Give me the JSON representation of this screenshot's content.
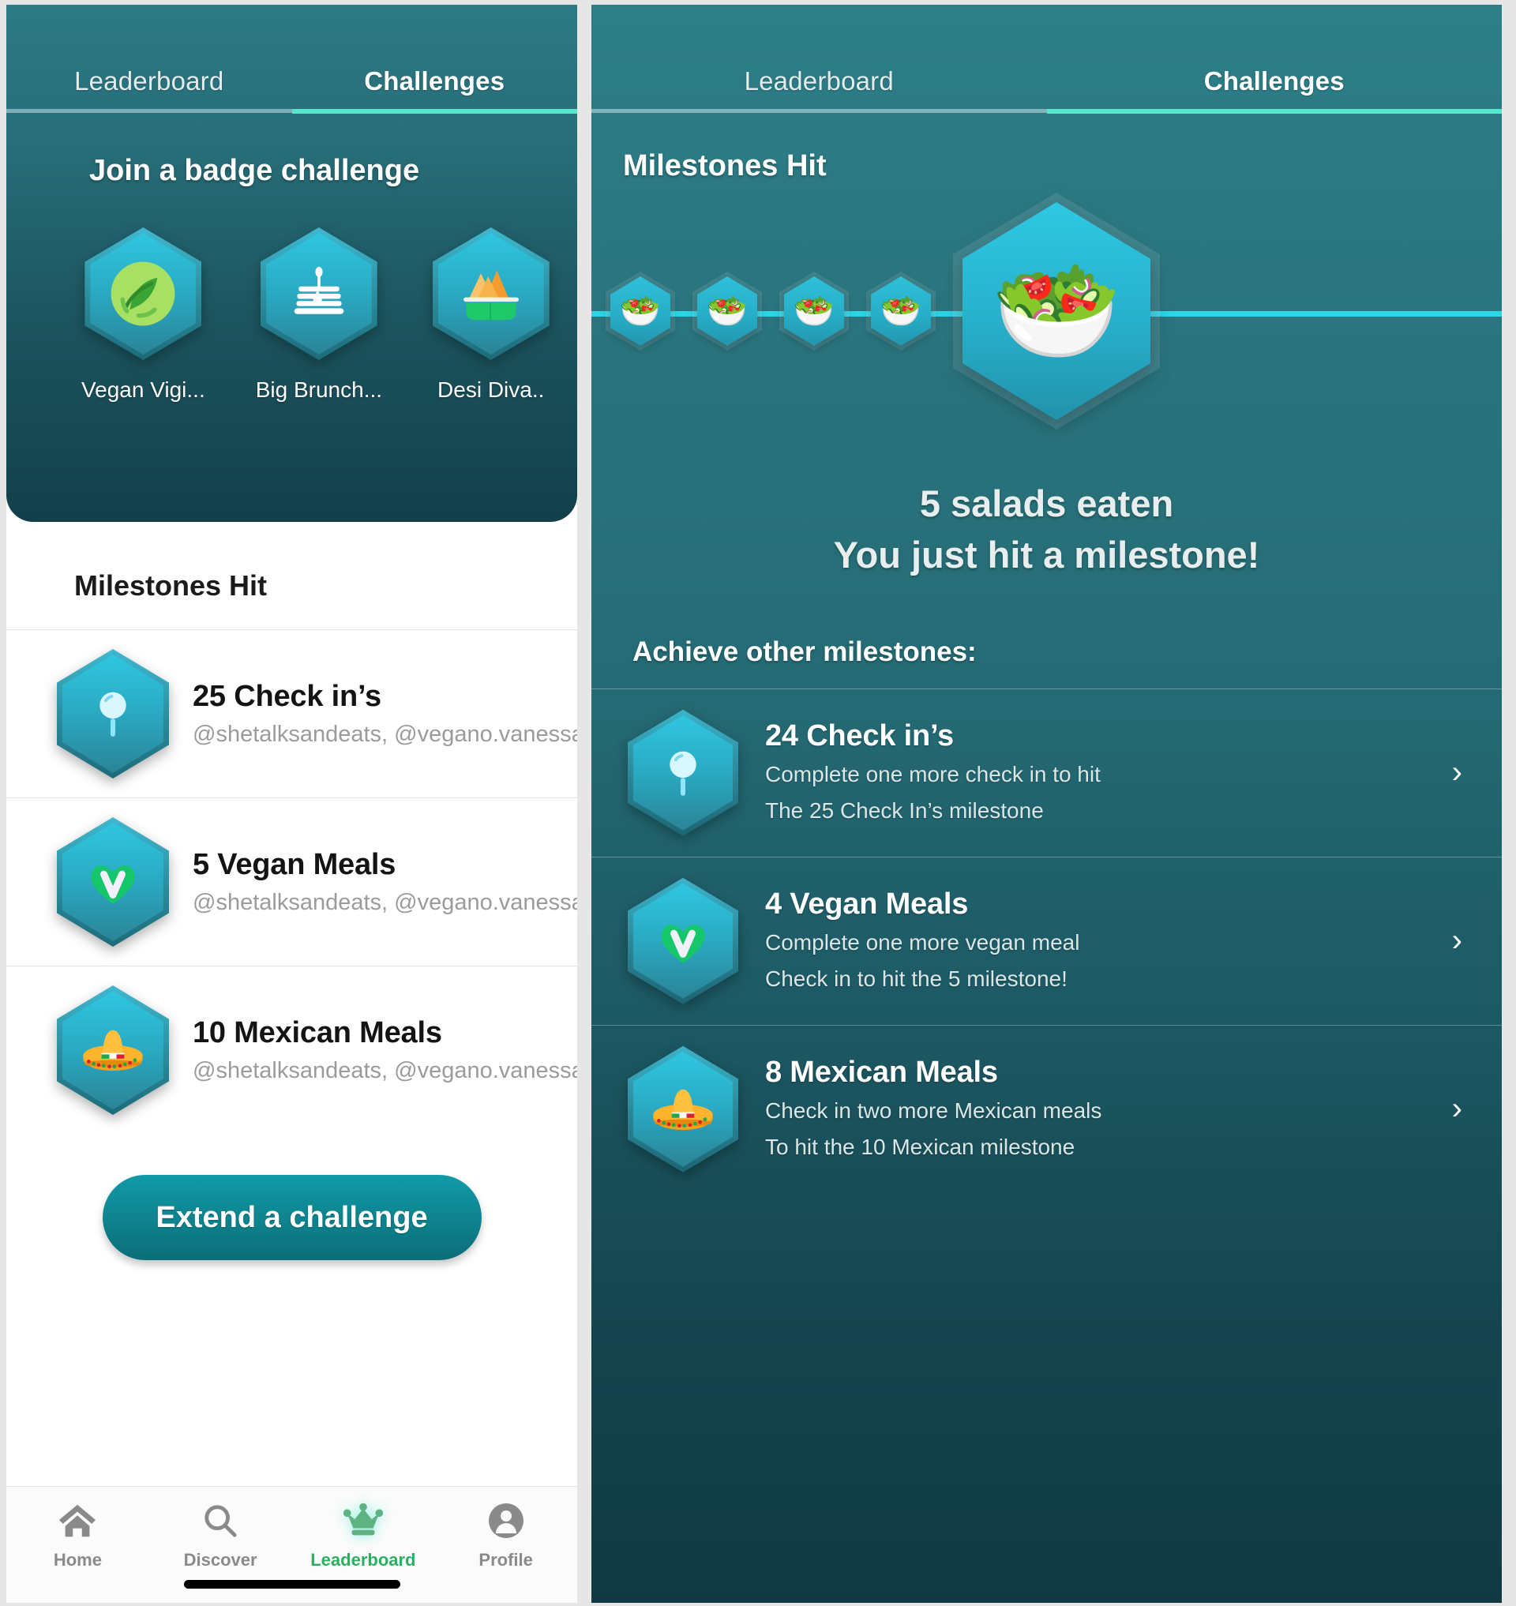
{
  "tabs": {
    "leaderboard": "Leaderboard",
    "challenges": "Challenges",
    "active": "Challenges"
  },
  "colors": {
    "accent_teal": "#2bd6e8",
    "tab_active_underline": "#55e8c8",
    "header_gradient_top": "#2d7a84",
    "header_gradient_bottom": "#123f4a",
    "nav_active_green": "#2fae63",
    "button_teal": "#0e8792",
    "sub_text_gray": "#9b9b9b"
  },
  "left_screen": {
    "hero_title": "Join a badge challenge",
    "badge_challenges": [
      {
        "label": "Vegan Vigi...",
        "icon": "leaf-badge-icon"
      },
      {
        "label": "Big Brunch...",
        "icon": "pancake-badge-icon"
      },
      {
        "label": "Desi Diva..",
        "icon": "samosa-badge-icon"
      },
      {
        "label": "",
        "icon": "partial-badge-icon"
      }
    ],
    "section_title": "Milestones Hit",
    "milestones": [
      {
        "title": "25 Check in’s",
        "subtitle": "@shetalksandeats, @vegano.vanessa",
        "icon": "magnifier-badge-icon",
        "chevron": "›"
      },
      {
        "title": "5 Vegan Meals",
        "subtitle": "@shetalksandeats, @vegano.vanessa",
        "icon": "vegan-heart-badge-icon",
        "chevron": "›"
      },
      {
        "title": "10 Mexican Meals",
        "subtitle": "@shetalksandeats, @vegano.vanessa",
        "icon": "sombrero-badge-icon",
        "chevron": "›"
      }
    ],
    "extend_button": "Extend a challenge",
    "bottom_nav": [
      {
        "label": "Home",
        "icon": "home-icon",
        "active": false
      },
      {
        "label": "Discover",
        "icon": "search-icon",
        "active": false
      },
      {
        "label": "Leaderboard",
        "icon": "crown-icon",
        "active": true
      },
      {
        "label": "Profile",
        "icon": "person-icon",
        "active": false
      }
    ]
  },
  "right_screen": {
    "title": "Milestones Hit",
    "progress_steps": [
      {
        "icon": "salad-icon",
        "size": "small"
      },
      {
        "icon": "salad-icon",
        "size": "small"
      },
      {
        "icon": "salad-icon",
        "size": "small"
      },
      {
        "icon": "salad-icon",
        "size": "small"
      },
      {
        "icon": "salad-icon",
        "size": "large"
      }
    ],
    "headline_line1": "5 salads eaten",
    "headline_line2": "You just hit a milestone!",
    "subheading": "Achieve other milestones:",
    "milestones": [
      {
        "title": "24 Check in’s",
        "desc_line1": "Complete one more check in to hit",
        "desc_line2": "The 25 Check In’s milestone",
        "icon": "magnifier-badge-icon",
        "chevron": "›"
      },
      {
        "title": "4 Vegan Meals",
        "desc_line1": "Complete one more vegan meal",
        "desc_line2": "Check in to hit the 5 milestone!",
        "icon": "vegan-heart-badge-icon",
        "chevron": "›"
      },
      {
        "title": "8 Mexican Meals",
        "desc_line1": "Check in two more Mexican meals",
        "desc_line2": "To hit the 10 Mexican milestone",
        "icon": "sombrero-badge-icon",
        "chevron": "›"
      }
    ]
  }
}
